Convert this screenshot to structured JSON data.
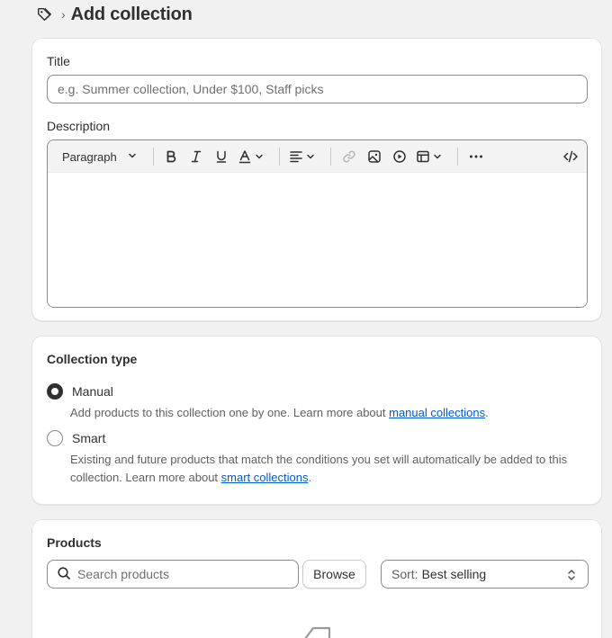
{
  "header": {
    "title": "Add collection",
    "separator": "›",
    "icon": "tag-icon"
  },
  "title_field": {
    "label": "Title",
    "placeholder": "e.g. Summer collection, Under $100, Staff picks"
  },
  "description": {
    "label": "Description",
    "format_select": "Paragraph",
    "toolbar_icons": [
      "bold-icon",
      "italic-icon",
      "underline-icon",
      "text-color-icon",
      "align-icon",
      "link-icon",
      "image-icon",
      "video-icon",
      "table-icon",
      "more-icon",
      "code-icon"
    ]
  },
  "collection_type": {
    "heading": "Collection type",
    "options": [
      {
        "label": "Manual",
        "selected": true,
        "help_prefix": "Add products to this collection one by one. Learn more about ",
        "help_link": "manual collections",
        "help_suffix": "."
      },
      {
        "label": "Smart",
        "selected": false,
        "help_prefix": "Existing and future products that match the conditions you set will automatically be added to this collection. Learn more about ",
        "help_link": "smart collections",
        "help_suffix": "."
      }
    ]
  },
  "products": {
    "heading": "Products",
    "search_placeholder": "Search products",
    "browse_label": "Browse",
    "sort_prefix": "Sort:",
    "sort_value": "Best selling"
  },
  "colors": {
    "link": "#005bd3",
    "text": "#303030",
    "background": "#f1f1f1"
  }
}
